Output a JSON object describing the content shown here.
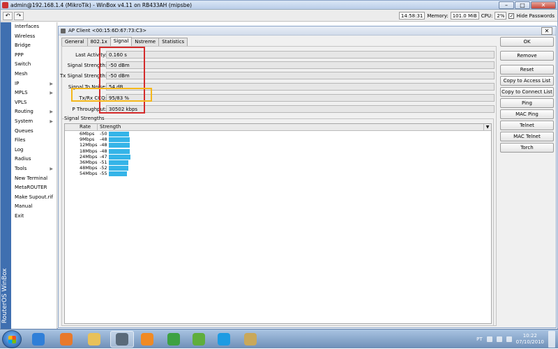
{
  "window": {
    "title": "admin@192.168.1.4 (MikroTik) - WinBox v4.11 on RB433AH (mipsbe)",
    "min": "–",
    "max": "□",
    "close": "✕"
  },
  "toolbar": {
    "undo": "↶",
    "redo": "↷",
    "time": "14:58:31",
    "memory_label": "Memory:",
    "memory": "101.0 MiB",
    "cpu_label": "CPU:",
    "cpu": "2%",
    "hide_passwords": "Hide Passwords",
    "hide_checked": "✓"
  },
  "sidebar": {
    "brand": "RouterOS WinBox",
    "items": [
      {
        "label": "Interfaces"
      },
      {
        "label": "Wireless"
      },
      {
        "label": "Bridge"
      },
      {
        "label": "PPP"
      },
      {
        "label": "Switch"
      },
      {
        "label": "Mesh"
      },
      {
        "label": "IP",
        "arrow": "▶"
      },
      {
        "label": "MPLS",
        "arrow": "▶"
      },
      {
        "label": "VPLS"
      },
      {
        "label": "Routing",
        "arrow": "▶"
      },
      {
        "label": "System",
        "arrow": "▶"
      },
      {
        "label": "Queues"
      },
      {
        "label": "Files"
      },
      {
        "label": "Log"
      },
      {
        "label": "Radius"
      },
      {
        "label": "Tools",
        "arrow": "▶"
      },
      {
        "label": "New Terminal"
      },
      {
        "label": "MetaROUTER"
      },
      {
        "label": "Make Supout.rif"
      },
      {
        "label": "Manual"
      },
      {
        "label": "Exit"
      }
    ]
  },
  "dialog": {
    "title": "AP Client <00:15:6D:67:73:C3>",
    "close": "✕",
    "tabs": [
      "General",
      "802.1x",
      "Signal",
      "Nstreme",
      "Statistics"
    ],
    "fields": [
      {
        "label": "Last Activity:",
        "value": "0.160 s"
      },
      {
        "label": "Signal Strength:",
        "value": "-50 dBm"
      },
      {
        "label": "Tx Signal Strength:",
        "value": "-50 dBm"
      },
      {
        "label": "Signal To Noise:",
        "value": "54 dB"
      },
      {
        "label": "Tx/Rx CCQ:",
        "value": "95/83 %"
      },
      {
        "label": "P Throughput:",
        "value": "30502 kbps"
      }
    ],
    "group_title": "Signal Strengths",
    "table": {
      "headers": [
        "Rate",
        "Strength"
      ],
      "sort_icon": "▼",
      "rows": [
        {
          "rate": "6Mbps",
          "strength": "-50",
          "level": 0.9
        },
        {
          "rate": "9Mbps",
          "strength": "-48",
          "level": 0.94
        },
        {
          "rate": "12Mbps",
          "strength": "-48",
          "level": 0.94
        },
        {
          "rate": "18Mbps",
          "strength": "-48",
          "level": 0.94
        },
        {
          "rate": "24Mbps",
          "strength": "-47",
          "level": 0.96
        },
        {
          "rate": "36Mbps",
          "strength": "-51",
          "level": 0.88
        },
        {
          "rate": "48Mbps",
          "strength": "-52",
          "level": 0.86
        },
        {
          "rate": "54Mbps",
          "strength": "-55",
          "level": 0.8
        }
      ]
    },
    "buttons": [
      "OK",
      "Remove",
      "Reset",
      "Copy to Access List",
      "Copy to Connect List",
      "Ping",
      "MAC Ping",
      "Telnet",
      "MAC Telnet",
      "Torch"
    ]
  },
  "taskbar": {
    "lang": "PT",
    "time": "10:22",
    "date": "07/10/2010",
    "apps": [
      {
        "name": "internet-explorer-icon",
        "color": "#2f7fd8"
      },
      {
        "name": "firefox-icon",
        "color": "#e8792b"
      },
      {
        "name": "explorer-folder-icon",
        "color": "#e8c15a"
      },
      {
        "name": "winbox-icon",
        "color": "#5a6a7a"
      },
      {
        "name": "media-player-icon",
        "color": "#f08a24"
      },
      {
        "name": "messenger-icon",
        "color": "#3da142"
      },
      {
        "name": "utorrent-icon",
        "color": "#5fae3c"
      },
      {
        "name": "skype-icon",
        "color": "#1d9be3"
      },
      {
        "name": "paint-icon",
        "color": "#c9a85a"
      }
    ]
  },
  "colors": {
    "accent": "#3f6fb0",
    "bar": "#35b4e8",
    "highlight_red": "#d42a2a",
    "highlight_yellow": "#f4b71a"
  }
}
